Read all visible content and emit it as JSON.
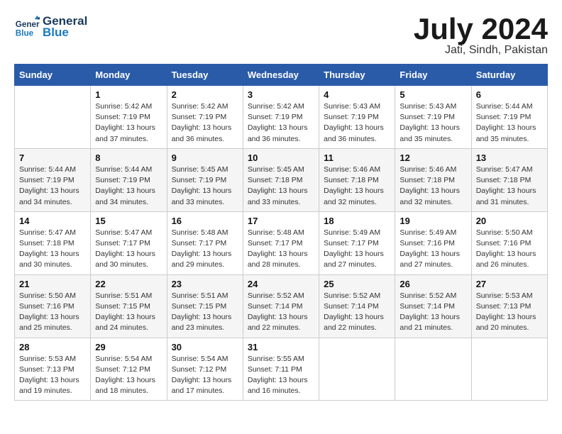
{
  "header": {
    "logo_line1": "General",
    "logo_line2": "Blue",
    "month": "July 2024",
    "location": "Jati, Sindh, Pakistan"
  },
  "days_of_week": [
    "Sunday",
    "Monday",
    "Tuesday",
    "Wednesday",
    "Thursday",
    "Friday",
    "Saturday"
  ],
  "weeks": [
    [
      {
        "day": "",
        "info": ""
      },
      {
        "day": "1",
        "info": "Sunrise: 5:42 AM\nSunset: 7:19 PM\nDaylight: 13 hours\nand 37 minutes."
      },
      {
        "day": "2",
        "info": "Sunrise: 5:42 AM\nSunset: 7:19 PM\nDaylight: 13 hours\nand 36 minutes."
      },
      {
        "day": "3",
        "info": "Sunrise: 5:42 AM\nSunset: 7:19 PM\nDaylight: 13 hours\nand 36 minutes."
      },
      {
        "day": "4",
        "info": "Sunrise: 5:43 AM\nSunset: 7:19 PM\nDaylight: 13 hours\nand 36 minutes."
      },
      {
        "day": "5",
        "info": "Sunrise: 5:43 AM\nSunset: 7:19 PM\nDaylight: 13 hours\nand 35 minutes."
      },
      {
        "day": "6",
        "info": "Sunrise: 5:44 AM\nSunset: 7:19 PM\nDaylight: 13 hours\nand 35 minutes."
      }
    ],
    [
      {
        "day": "7",
        "info": "Sunrise: 5:44 AM\nSunset: 7:19 PM\nDaylight: 13 hours\nand 34 minutes."
      },
      {
        "day": "8",
        "info": "Sunrise: 5:44 AM\nSunset: 7:19 PM\nDaylight: 13 hours\nand 34 minutes."
      },
      {
        "day": "9",
        "info": "Sunrise: 5:45 AM\nSunset: 7:19 PM\nDaylight: 13 hours\nand 33 minutes."
      },
      {
        "day": "10",
        "info": "Sunrise: 5:45 AM\nSunset: 7:18 PM\nDaylight: 13 hours\nand 33 minutes."
      },
      {
        "day": "11",
        "info": "Sunrise: 5:46 AM\nSunset: 7:18 PM\nDaylight: 13 hours\nand 32 minutes."
      },
      {
        "day": "12",
        "info": "Sunrise: 5:46 AM\nSunset: 7:18 PM\nDaylight: 13 hours\nand 32 minutes."
      },
      {
        "day": "13",
        "info": "Sunrise: 5:47 AM\nSunset: 7:18 PM\nDaylight: 13 hours\nand 31 minutes."
      }
    ],
    [
      {
        "day": "14",
        "info": "Sunrise: 5:47 AM\nSunset: 7:18 PM\nDaylight: 13 hours\nand 30 minutes."
      },
      {
        "day": "15",
        "info": "Sunrise: 5:47 AM\nSunset: 7:17 PM\nDaylight: 13 hours\nand 30 minutes."
      },
      {
        "day": "16",
        "info": "Sunrise: 5:48 AM\nSunset: 7:17 PM\nDaylight: 13 hours\nand 29 minutes."
      },
      {
        "day": "17",
        "info": "Sunrise: 5:48 AM\nSunset: 7:17 PM\nDaylight: 13 hours\nand 28 minutes."
      },
      {
        "day": "18",
        "info": "Sunrise: 5:49 AM\nSunset: 7:17 PM\nDaylight: 13 hours\nand 27 minutes."
      },
      {
        "day": "19",
        "info": "Sunrise: 5:49 AM\nSunset: 7:16 PM\nDaylight: 13 hours\nand 27 minutes."
      },
      {
        "day": "20",
        "info": "Sunrise: 5:50 AM\nSunset: 7:16 PM\nDaylight: 13 hours\nand 26 minutes."
      }
    ],
    [
      {
        "day": "21",
        "info": "Sunrise: 5:50 AM\nSunset: 7:16 PM\nDaylight: 13 hours\nand 25 minutes."
      },
      {
        "day": "22",
        "info": "Sunrise: 5:51 AM\nSunset: 7:15 PM\nDaylight: 13 hours\nand 24 minutes."
      },
      {
        "day": "23",
        "info": "Sunrise: 5:51 AM\nSunset: 7:15 PM\nDaylight: 13 hours\nand 23 minutes."
      },
      {
        "day": "24",
        "info": "Sunrise: 5:52 AM\nSunset: 7:14 PM\nDaylight: 13 hours\nand 22 minutes."
      },
      {
        "day": "25",
        "info": "Sunrise: 5:52 AM\nSunset: 7:14 PM\nDaylight: 13 hours\nand 22 minutes."
      },
      {
        "day": "26",
        "info": "Sunrise: 5:52 AM\nSunset: 7:14 PM\nDaylight: 13 hours\nand 21 minutes."
      },
      {
        "day": "27",
        "info": "Sunrise: 5:53 AM\nSunset: 7:13 PM\nDaylight: 13 hours\nand 20 minutes."
      }
    ],
    [
      {
        "day": "28",
        "info": "Sunrise: 5:53 AM\nSunset: 7:13 PM\nDaylight: 13 hours\nand 19 minutes."
      },
      {
        "day": "29",
        "info": "Sunrise: 5:54 AM\nSunset: 7:12 PM\nDaylight: 13 hours\nand 18 minutes."
      },
      {
        "day": "30",
        "info": "Sunrise: 5:54 AM\nSunset: 7:12 PM\nDaylight: 13 hours\nand 17 minutes."
      },
      {
        "day": "31",
        "info": "Sunrise: 5:55 AM\nSunset: 7:11 PM\nDaylight: 13 hours\nand 16 minutes."
      },
      {
        "day": "",
        "info": ""
      },
      {
        "day": "",
        "info": ""
      },
      {
        "day": "",
        "info": ""
      }
    ]
  ]
}
